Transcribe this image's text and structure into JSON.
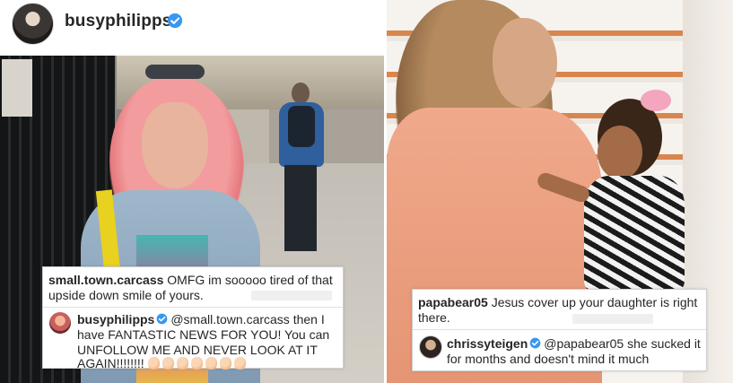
{
  "left_post": {
    "account": {
      "username": "busyphilipps",
      "verified": true
    },
    "comment": {
      "username": "small.town.carcass",
      "line1": "OMFG im sooooo tired of that",
      "line2": "upside down smile of yours."
    },
    "reply": {
      "username": "busyphilipps",
      "verified": true,
      "mention": "@small.town.carcass",
      "line1_tail": "then I",
      "line2": "have FANTASTIC NEWS FOR YOU! You can",
      "line3": "UNFOLLOW ME AND NEVER LOOK AT IT",
      "line4": "AGAIN!!!!!!!!",
      "emoji": "clapping-hands-icon",
      "emoji_count": 7
    }
  },
  "right_post": {
    "comment": {
      "username": "papabear05",
      "line1": "Jesus cover up your daughter is right",
      "line2": "there."
    },
    "reply": {
      "username": "chrissyteigen",
      "verified": true,
      "mention": "@papabear05",
      "line1_tail": "she sucked it",
      "line2": "for months and doesn't mind it much"
    }
  },
  "colors": {
    "verified_badge": "#3897f0",
    "text": "#262626",
    "card_border": "#cfcfcf"
  }
}
